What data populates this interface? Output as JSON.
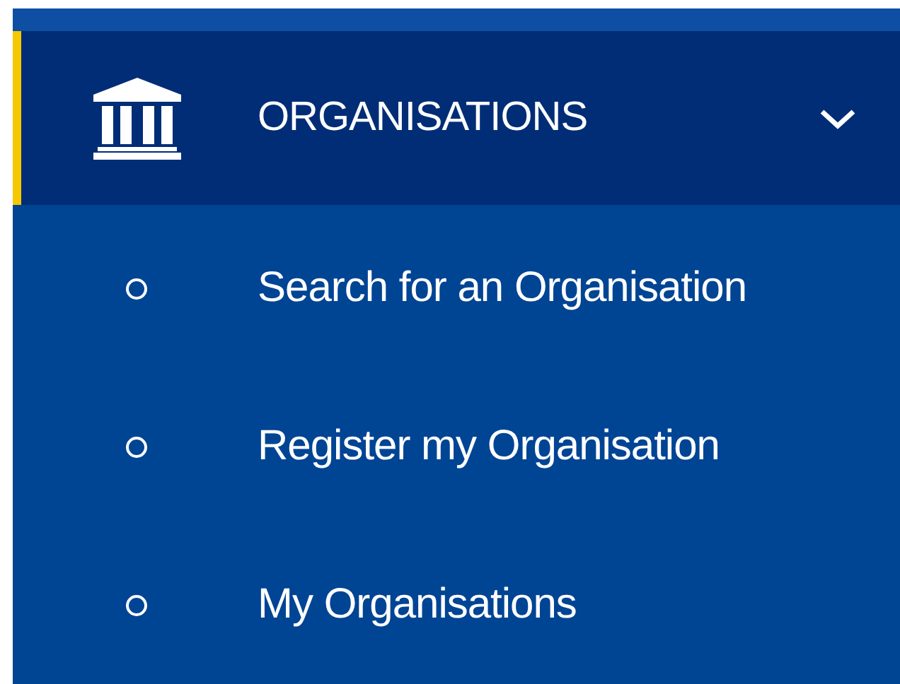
{
  "menu": {
    "label": "ORGANISATIONS",
    "active": true,
    "expanded": true,
    "items": [
      {
        "label": "Search for an Organisation"
      },
      {
        "label": "Register my Organisation"
      },
      {
        "label": "My Organisations"
      }
    ]
  }
}
